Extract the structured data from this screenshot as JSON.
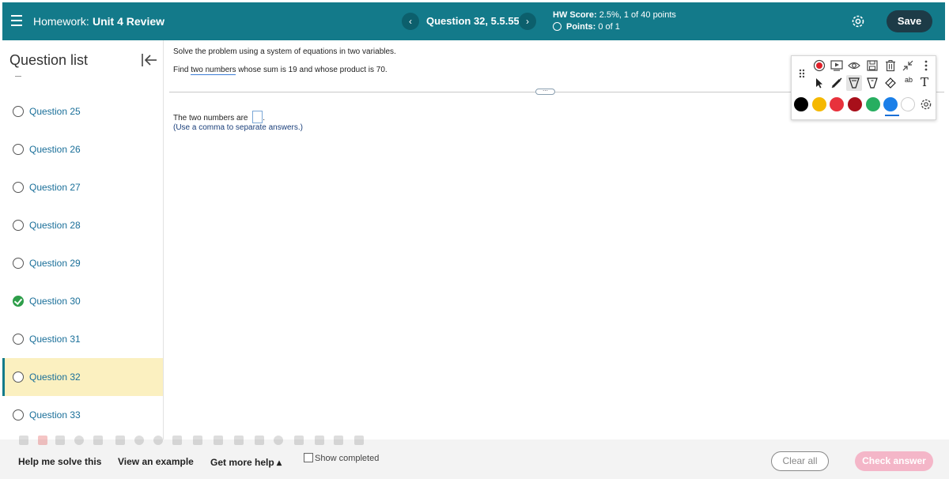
{
  "topbar": {
    "hw_prefix": "Homework:",
    "hw_title": "Unit 4 Review",
    "prev_symbol": "‹",
    "next_symbol": "›",
    "question_title": "Question 32, 5.5.55",
    "hw_score_label": "HW Score:",
    "hw_score_value": "2.5%, 1 of 40 points",
    "points_label": "Points:",
    "points_value": "0 of 1",
    "save_label": "Save"
  },
  "sidebar": {
    "heading": "Question list",
    "questions": [
      {
        "label": "Question 25",
        "status": "incomplete"
      },
      {
        "label": "Question 26",
        "status": "incomplete"
      },
      {
        "label": "Question 27",
        "status": "incomplete"
      },
      {
        "label": "Question 28",
        "status": "incomplete"
      },
      {
        "label": "Question 29",
        "status": "incomplete"
      },
      {
        "label": "Question 30",
        "status": "complete"
      },
      {
        "label": "Question 31",
        "status": "incomplete"
      },
      {
        "label": "Question 32",
        "status": "current"
      },
      {
        "label": "Question 33",
        "status": "incomplete"
      }
    ]
  },
  "main": {
    "instruction": "Solve the problem using a system of equations in two variables.",
    "prompt_before": "Find ",
    "prompt_highlight": "two numbers",
    "prompt_after": " whose sum is 19 and whose product is 70.",
    "answer_prefix": "The two numbers are",
    "answer_suffix": ".",
    "answer_hint": "(Use a comma to separate answers.)",
    "divider_handle": "⋯"
  },
  "annotation_toolbar": {
    "colors": [
      "#000000",
      "#f5b800",
      "#e8323c",
      "#a80f1a",
      "#27ae60",
      "#1a7fe8",
      "#ffffff"
    ],
    "selected_color": "#1a7fe8",
    "text_tool_glyph": "T",
    "abc_label": "ab"
  },
  "bottombar": {
    "help_solve": "Help me solve this",
    "view_example": "View an example",
    "more_help": "Get more help ▴",
    "show_completed": "Show completed",
    "clear_all": "Clear all",
    "check_answer": "Check answer"
  }
}
